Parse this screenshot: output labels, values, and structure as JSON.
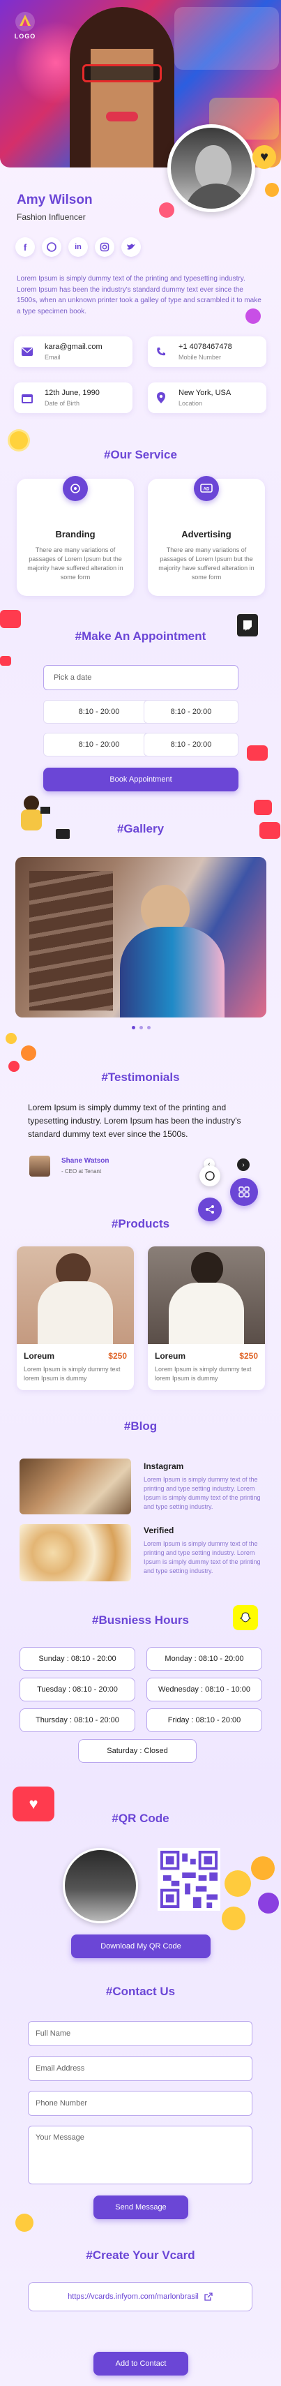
{
  "profile": {
    "name": "Amy Wilson",
    "title": "Fashion Influencer",
    "logo_text": "LOGO",
    "bio": "Lorem Ipsum is simply dummy text of the printing and typesetting industry. Lorem Ipsum has been the industry's standard dummy text ever since the 1500s, when an unknown printer took a galley of type and scrambled it to make a type specimen book."
  },
  "contact_info": [
    {
      "icon": "mail-icon",
      "value": "kara@gmail.com",
      "label": "Email"
    },
    {
      "icon": "phone-icon",
      "value": "+1 4078467478",
      "label": "Mobile Number"
    },
    {
      "icon": "calendar-icon",
      "value": "12th June, 1990",
      "label": "Date of Birth"
    },
    {
      "icon": "location-icon",
      "value": "New York, USA",
      "label": "Location"
    }
  ],
  "social": [
    "facebook-icon",
    "whatsapp-icon",
    "linkedin-icon",
    "instagram-icon",
    "twitter-icon"
  ],
  "services": {
    "title": "#Our Service",
    "items": [
      {
        "name": "Branding",
        "desc": "There are many variations of passages of Lorem Ipsum but the majority have suffered alteration in some form"
      },
      {
        "name": "Advertising",
        "desc": "There are many variations of passages of Lorem Ipsum but the majority have suffered alteration in some form"
      }
    ]
  },
  "appointment": {
    "title": "#Make An Appointment",
    "date_placeholder": "Pick a date",
    "slots": [
      "8:10 - 20:00",
      "8:10 - 20:00",
      "8:10 - 20:00",
      "8:10 - 20:00"
    ],
    "button": "Book Appointment"
  },
  "gallery": {
    "title": "#Gallery"
  },
  "testimonials": {
    "title": "#Testimonials",
    "text": "Lorem Ipsum is simply dummy text of the printing and typesetting industry. Lorem Ipsum has been the industry's standard dummy text ever since the 1500s.",
    "author": "Shane Watson",
    "role": "- CEO at Tenant"
  },
  "products": {
    "title": "#Products",
    "items": [
      {
        "name": "Loreum",
        "price": "$250",
        "desc": "Lorem Ipsum is simply dummy text lorem Ipsum is dummy"
      },
      {
        "name": "Loreum",
        "price": "$250",
        "desc": "Lorem Ipsum is simply dummy text lorem Ipsum is dummy"
      }
    ]
  },
  "blog": {
    "title": "#Blog",
    "items": [
      {
        "name": "Instagram",
        "desc": "Lorem Ipsum is simply dummy text of the printing and type setting industry. Lorem Ipsum is simply dummy text of the printing and type setting industry."
      },
      {
        "name": "Verified",
        "desc": "Lorem Ipsum is simply dummy text of the printing and type setting industry. Lorem Ipsum is simply dummy text of the printing and type setting industry."
      }
    ]
  },
  "hours": {
    "title": "#Busniess Hours",
    "items": [
      "Sunday : 08:10 - 20:00",
      "Monday : 08:10 - 20:00",
      "Tuesday : 08:10 - 20:00",
      "Wednesday : 08:10 - 10:00",
      "Thursday : 08:10 - 20:00",
      "Friday : 08:10 - 20:00",
      "Saturday : Closed"
    ]
  },
  "qr": {
    "title": "#QR Code",
    "button": "Download My QR Code"
  },
  "contact": {
    "title": "#Contact Us",
    "full_name": "Full Name",
    "email": "Email Address",
    "phone": "Phone Number",
    "message": "Your Message",
    "button": "Send Message"
  },
  "vcard": {
    "title": "#Create Your Vcard",
    "url": "https://vcards.infyom.com/marlonbrasil",
    "button": "Add to Contact"
  },
  "colors": {
    "accent": "#6b46d6",
    "price": "#e0662a",
    "bg": "#f5efff"
  }
}
